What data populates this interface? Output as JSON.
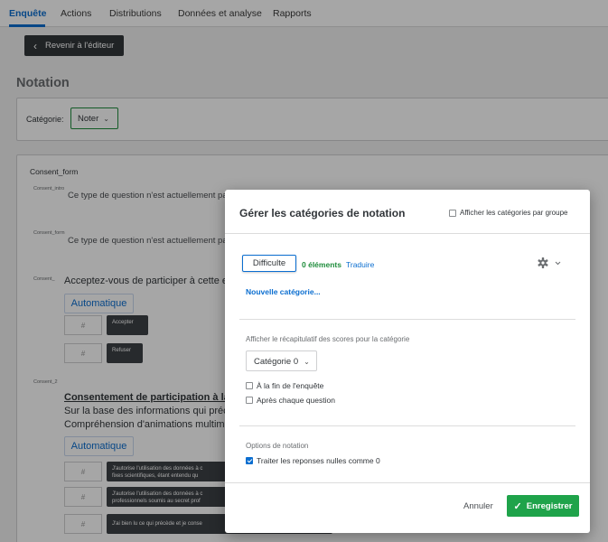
{
  "nav": {
    "tabs": [
      "Enquête",
      "Actions",
      "Distributions",
      "Données et analyse",
      "Rapports"
    ]
  },
  "back_button": "Revenir à l'éditeur",
  "page_title": "Notation",
  "category_bar": {
    "label": "Catégorie:",
    "value": "Noter"
  },
  "survey": {
    "block_title": "Consent_form",
    "questions": [
      {
        "id": "Consent_intro",
        "text": "Ce type de question n'est actuellement pas"
      },
      {
        "id": "Consent_form",
        "text": "Ce type de question n'est actuellement pas"
      },
      {
        "id": "Consent_",
        "text": "Acceptez-vous de participer à cette exp",
        "auto": "Automatique",
        "choices": [
          "Accepter",
          "Refuser"
        ],
        "placeholder": "#"
      },
      {
        "id": "Consent_2",
        "title": "Consentement de participation à la rech",
        "lines": [
          "Sur la base des informations qui précéd",
          "Compréhension d'animations multiméd"
        ],
        "auto": "Automatique",
        "choices": [
          "J'autorise l'utilisation des données à c",
          "J'autorise l'utilisation des données à c",
          "J'ai bien lu ce qui précède et je conse"
        ],
        "choices_line2": [
          "fixes scientifiques, étant entendu qu",
          "professionnels soumis au secret prof",
          ""
        ],
        "placeholder": "#"
      }
    ]
  },
  "modal": {
    "title": "Gérer les catégories de notation",
    "group_toggle": "Afficher les catégories par groupe",
    "category_name": "Difficulte",
    "items_count": "0 éléments",
    "translate": "Traduire",
    "new_category": "Nouvelle catégorie...",
    "summary_label": "Afficher le récapitulatif des scores pour la catégorie",
    "summary_select": "Catégorie 0",
    "opt_end": "À la fin de l'enquête",
    "opt_each": "Après chaque question",
    "scoring_options_label": "Options de notation",
    "treat_null": "Traiter les reponses nulles comme 0",
    "cancel": "Annuler",
    "save": "Enregistrer"
  },
  "colors": {
    "accent": "#0b6ed0",
    "success": "#1fa34a",
    "dark": "#32363a"
  },
  "icons": [
    "chevron-left-icon",
    "chevron-down-icon",
    "gear-icon",
    "checkmark-icon"
  ]
}
